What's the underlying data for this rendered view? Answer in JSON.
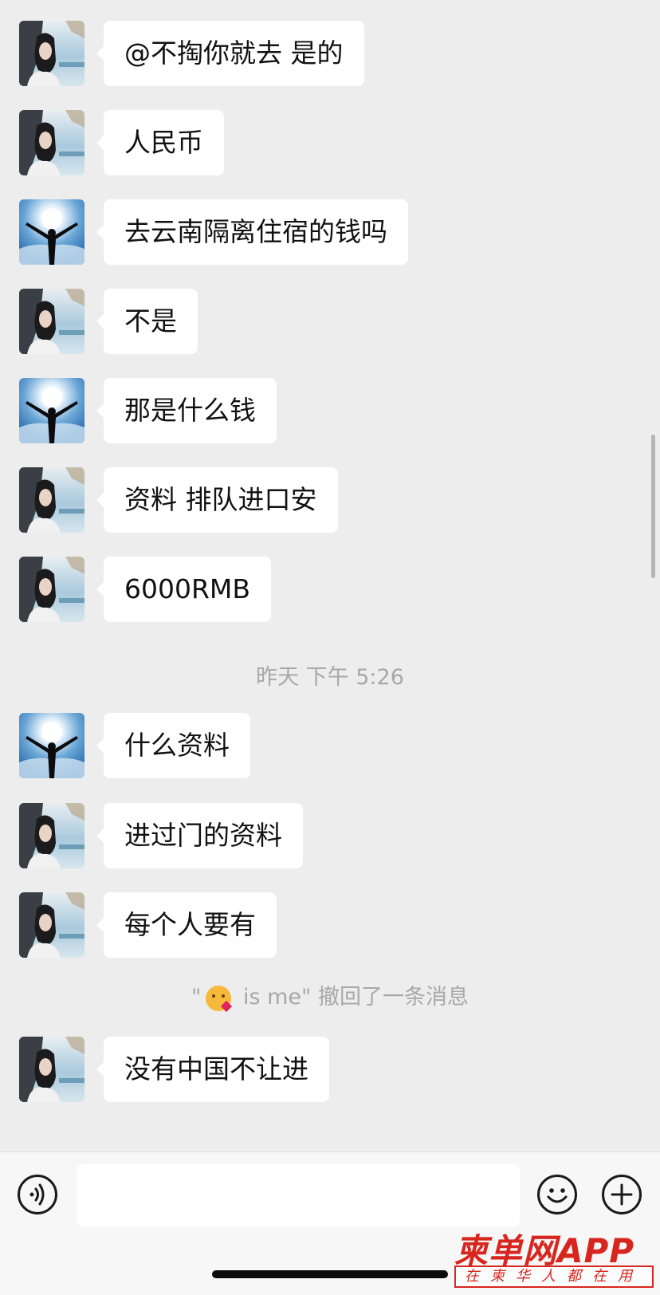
{
  "chat": {
    "messages": [
      {
        "sender": "girl",
        "text": "@不掏你就去 是的"
      },
      {
        "sender": "girl",
        "text": "人民币"
      },
      {
        "sender": "man",
        "text": "去云南隔离住宿的钱吗"
      },
      {
        "sender": "girl",
        "text": "不是"
      },
      {
        "sender": "man",
        "text": "那是什么钱"
      },
      {
        "sender": "girl",
        "text": "资料 排队进口安"
      },
      {
        "sender": "girl",
        "text": "6000RMB"
      },
      {
        "sender": "man",
        "text": "什么资料"
      },
      {
        "sender": "girl",
        "text": "进过门的资料"
      },
      {
        "sender": "girl",
        "text": "每个人要有"
      },
      {
        "sender": "girl",
        "text": "没有中国不让进"
      }
    ],
    "timestamp": "昨天 下午 5:26",
    "recall_notice": {
      "prefix": "\"",
      "emoji": "kissing-face-emoji",
      "suffix": " is me\" 撤回了一条消息"
    }
  },
  "input_bar": {
    "voice_icon": "voice-icon",
    "message_value": "",
    "emoji_icon": "emoji-smile-icon",
    "plus_icon": "plus-icon"
  },
  "watermark": {
    "title": "柬单网APP",
    "subtitle": "在柬华人都在用"
  },
  "colors": {
    "background": "#ededed",
    "bubble": "#ffffff",
    "system_text": "#a8a8a8",
    "watermark": "#d8261f"
  }
}
